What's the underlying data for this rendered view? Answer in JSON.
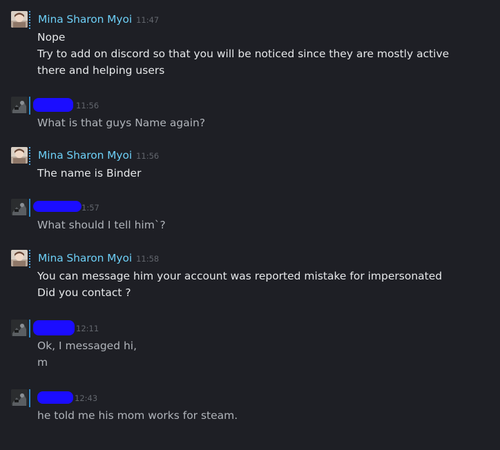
{
  "colors": {
    "background": "#1e1f25",
    "name": "#6dcff6",
    "timestamp": "#62666d",
    "own_text": "#e6e8ea",
    "other_text": "#b0b4ba",
    "redaction": "#1b0dff"
  },
  "messages": [
    {
      "sender": "Mina Sharon Myoi",
      "time": "11:47",
      "lines": [
        "Nope",
        "Try to add on discord so that you will be noticed since they are mostly active",
        "there and helping users"
      ]
    },
    {
      "sender": "",
      "time": "11:56",
      "lines": [
        "What is that guys Name again?"
      ]
    },
    {
      "sender": "Mina Sharon Myoi",
      "time": "11:56",
      "lines": [
        "The name is Binder"
      ]
    },
    {
      "sender": "",
      "time": "1:57",
      "lines": [
        "What should I tell him`?"
      ]
    },
    {
      "sender": "Mina Sharon Myoi",
      "time": "11:58",
      "lines": [
        "You can message him your account was reported mistake for impersonated",
        "Did you contact ?"
      ]
    },
    {
      "sender": "",
      "time": "12:11",
      "lines": [
        "Ok, I messaged hi,",
        "m"
      ]
    },
    {
      "sender": "",
      "time": "12:43",
      "lines": [
        "he told me his mom works for steam."
      ]
    }
  ]
}
